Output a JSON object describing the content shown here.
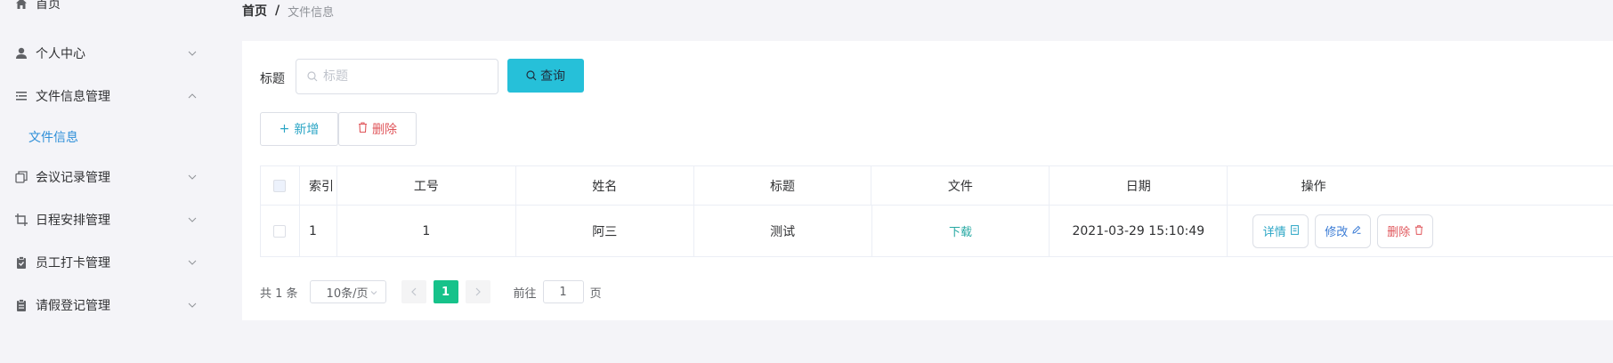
{
  "sidebar": {
    "items": [
      {
        "label": "首页",
        "icon": "home-icon"
      },
      {
        "label": "个人中心",
        "icon": "user-icon"
      },
      {
        "label": "文件信息管理",
        "icon": "list-icon"
      },
      {
        "label": "文件信息",
        "icon": ""
      },
      {
        "label": "会议记录管理",
        "icon": "copy-icon"
      },
      {
        "label": "日程安排管理",
        "icon": "crop-icon"
      },
      {
        "label": "员工打卡管理",
        "icon": "clipboard-check-icon"
      },
      {
        "label": "请假登记管理",
        "icon": "clipboard-icon"
      }
    ]
  },
  "breadcrumb": {
    "home": "首页",
    "separator": "/",
    "current": "文件信息"
  },
  "search": {
    "label": "标题",
    "placeholder": "标题",
    "value": "",
    "query_label": "查询"
  },
  "toolbar": {
    "add_label": "新增",
    "delete_label": "删除"
  },
  "table": {
    "headers": {
      "index": "索引",
      "no": "工号",
      "name": "姓名",
      "title": "标题",
      "file": "文件",
      "date": "日期",
      "ops": "操作"
    },
    "rows": [
      {
        "index": "1",
        "no": "1",
        "name": "阿三",
        "title": "测试",
        "file": "下载",
        "date": "2021-03-29 15:10:49",
        "detail": "详情",
        "edit": "修改",
        "delete": "删除"
      }
    ]
  },
  "pagination": {
    "total": "共 1 条",
    "page_size": "10条/页",
    "current_page": "1",
    "goto_prefix": "前往",
    "goto_value": "1",
    "goto_suffix": "页"
  },
  "colors": {
    "accent": "#26c0d9",
    "page_active": "#16c28a",
    "danger": "#e0565b",
    "link": "#2e8fd8"
  }
}
